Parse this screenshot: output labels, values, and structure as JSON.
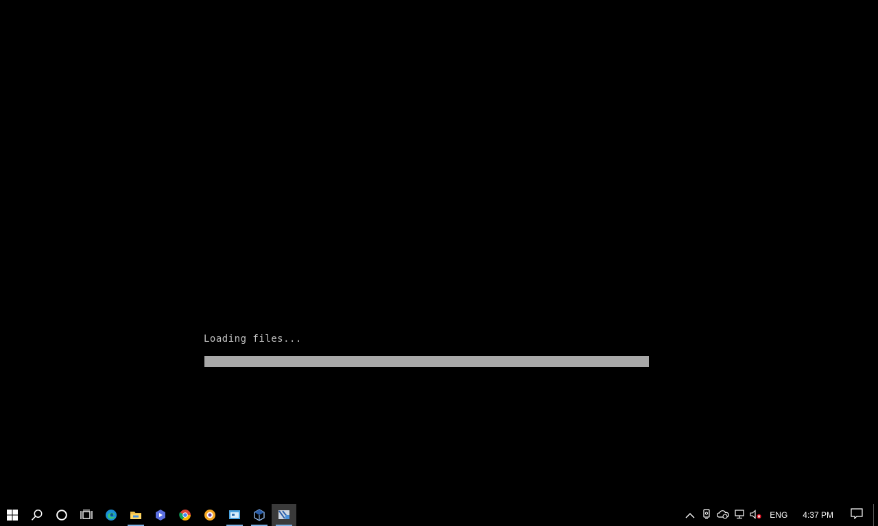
{
  "vm_screen": {
    "loading_text": "Loading files...",
    "progress_fraction": 0.0
  },
  "taskbar": {
    "pinned": [
      {
        "name": "start-button",
        "icon": "windows-logo-icon"
      },
      {
        "name": "search-button",
        "icon": "search-icon"
      },
      {
        "name": "cortana-button",
        "icon": "cortana-circle-icon"
      },
      {
        "name": "task-view-button",
        "icon": "task-view-icon"
      },
      {
        "name": "edge-button",
        "icon": "edge-icon"
      },
      {
        "name": "file-explorer-button",
        "icon": "folder-icon"
      },
      {
        "name": "app-button",
        "icon": "app-hexagon-icon"
      },
      {
        "name": "chrome-button",
        "icon": "chrome-icon"
      },
      {
        "name": "app-orange-button",
        "icon": "orange-app-icon"
      },
      {
        "name": "app-window-button",
        "icon": "window-app-icon"
      },
      {
        "name": "virtualbox-button",
        "icon": "virtualbox-icon"
      },
      {
        "name": "vm-window-button",
        "icon": "vm-window-icon"
      }
    ],
    "tray": {
      "language": "ENG",
      "time": "4:37 PM"
    }
  },
  "colors": {
    "background": "#000000",
    "loading_text": "#c0c0c0",
    "progress_track": "#a8a8a8",
    "taskbar_accent": "#7fb3e6"
  }
}
